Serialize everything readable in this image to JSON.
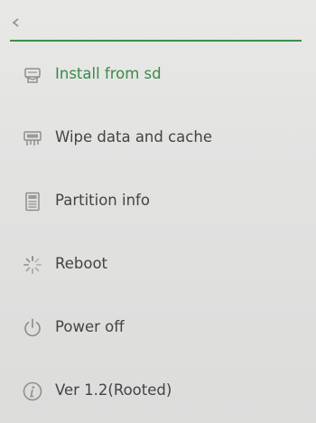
{
  "header": {
    "back_icon": "back-arrow-icon",
    "accent_color": "#3b8f4a"
  },
  "menu": {
    "items": [
      {
        "label": "Install from sd",
        "icon": "sd-install-icon",
        "active": true
      },
      {
        "label": "Wipe data and cache",
        "icon": "wipe-icon",
        "active": false
      },
      {
        "label": "Partition info",
        "icon": "partition-icon",
        "active": false
      },
      {
        "label": "Reboot",
        "icon": "reboot-spinner-icon",
        "active": false
      },
      {
        "label": "Power off",
        "icon": "power-icon",
        "active": false
      },
      {
        "label": "Ver 1.2(Rooted)",
        "icon": "info-icon",
        "active": false
      }
    ]
  },
  "colors": {
    "active_text": "#3a8a4c",
    "text": "#444444",
    "icon": "#8f8f8f"
  }
}
